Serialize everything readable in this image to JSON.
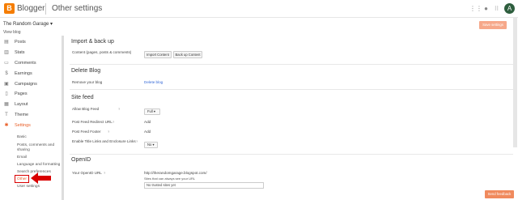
{
  "header": {
    "brand": "Blogger",
    "page_title": "Other settings",
    "avatar_letter": "A"
  },
  "sidebar": {
    "blog_name": "The Random Garage ▾",
    "view_blog": "View blog",
    "items": [
      {
        "label": "Posts",
        "icon": "posts-icon",
        "glyph": "▤"
      },
      {
        "label": "Stats",
        "icon": "stats-icon",
        "glyph": "▥"
      },
      {
        "label": "Comments",
        "icon": "comments-icon",
        "glyph": "▭"
      },
      {
        "label": "Earnings",
        "icon": "earnings-icon",
        "glyph": "$"
      },
      {
        "label": "Campaigns",
        "icon": "campaigns-icon",
        "glyph": "▣"
      },
      {
        "label": "Pages",
        "icon": "pages-icon",
        "glyph": "▯"
      },
      {
        "label": "Layout",
        "icon": "layout-icon",
        "glyph": "▦"
      },
      {
        "label": "Theme",
        "icon": "theme-icon",
        "glyph": "T"
      },
      {
        "label": "Settings",
        "icon": "settings-icon",
        "glyph": "✱"
      }
    ],
    "sub_items": [
      "Basic",
      "Posts, comments and",
      "sharing",
      "Email",
      "Language and formatting",
      "Search preferences",
      "Other",
      "User settings"
    ]
  },
  "main": {
    "save_label": "Save settings",
    "import": {
      "title": "Import & back up",
      "label": "Content (pages, posts & comments)",
      "import_btn": "Import Content",
      "backup_btn": "Back up Content"
    },
    "delete": {
      "title": "Delete Blog",
      "label": "Remove your blog",
      "link": "Delete blog"
    },
    "feed": {
      "title": "Site feed",
      "allow_label": "Allow Blog Feed",
      "allow_value": "Full ▾",
      "redirect_label": "Post Feed Redirect URL",
      "redirect_value": "Add",
      "footer_label": "Post Feed Footer",
      "footer_value": "Add",
      "enclosure_label": "Enable Title Links and Enclosure Links",
      "enclosure_value": "No ▾"
    },
    "openid": {
      "title": "OpenID",
      "label": "Your OpenID URL",
      "url": "http://therandomgarage.blogspot.com/",
      "help": "Sites that can always see your URL",
      "placeholder": "No trusted sites yet"
    },
    "feedback_label": "Send feedback"
  },
  "colors": {
    "accent": "#e95f28",
    "brand": "#f57d00",
    "highlight": "#d90000"
  }
}
